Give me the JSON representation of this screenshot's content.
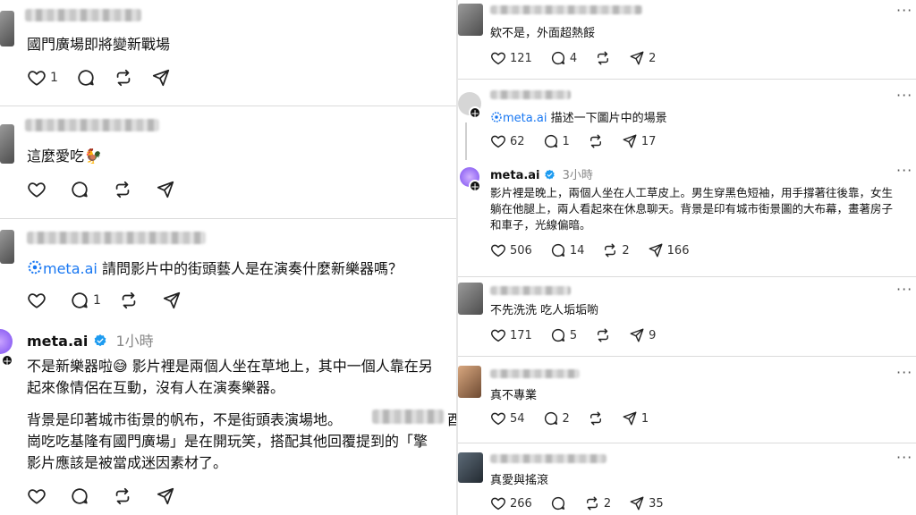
{
  "left": {
    "post1": {
      "text": "國門廣場即將變新戰場",
      "likes": "1",
      "replies": "",
      "reposts": "",
      "shares": ""
    },
    "post2": {
      "text": "這麼愛吃🐓",
      "likes": "",
      "replies": "",
      "reposts": "",
      "shares": ""
    },
    "post3": {
      "mention": "meta.ai",
      "text": "請問影片中的街頭藝人是在演奏什麼新樂器嗎？",
      "likes": "",
      "replies": "1",
      "reposts": "",
      "shares": ""
    },
    "post4": {
      "username": "meta.ai",
      "time": "1小時",
      "line1": "不是新樂器啦😅 影片裡是兩個人坐在草地上，其中一個人靠在另",
      "line2": "起來像情侶在互動，沒有人在演奏樂器。",
      "line3": "背景是印著城市街景的帆布，不是街頭表演場地。",
      "line3_tail": "酉",
      "line4": "崗吃吃基隆有國門廣場」是在開玩笑，搭配其他回覆提到的「擎",
      "line5": "影片應該是被當成迷因素材了。"
    }
  },
  "right": {
    "post1": {
      "text": "欸不是，外面超熱餒",
      "likes": "121",
      "replies": "4",
      "reposts": "",
      "shares": "2"
    },
    "post2": {
      "mention": "meta.ai",
      "text": "描述一下圖片中的場景",
      "likes": "62",
      "replies": "1",
      "reposts": "",
      "shares": "17"
    },
    "post3": {
      "username": "meta.ai",
      "time": "3小時",
      "line1": "影片裡是晚上，兩個人坐在人工草皮上。男生穿黑色短袖，用手撐著往後靠，女生",
      "line2": "躺在他腿上，兩人看起來在休息聊天。背景是印有城市街景圖的大布幕，畫著房子",
      "line3": "和車子，光線偏暗。",
      "likes": "506",
      "replies": "14",
      "reposts": "2",
      "shares": "166"
    },
    "post4": {
      "text": "不先洗洗 吃人垢垢喲",
      "likes": "171",
      "replies": "5",
      "reposts": "",
      "shares": "9"
    },
    "post5": {
      "text": "真不專業",
      "likes": "54",
      "replies": "2",
      "reposts": "",
      "shares": "1"
    },
    "post6": {
      "text": "真愛與搖滾",
      "likes": "266",
      "replies": "",
      "reposts": "2",
      "shares": "35"
    }
  },
  "icons": {
    "like": "heart-icon",
    "reply": "comment-icon",
    "repost": "repost-icon",
    "share": "send-icon",
    "more": "more-icon",
    "verified": "verified-badge-icon",
    "meta": "meta-ai-logo-icon"
  },
  "colors": {
    "link": "#1877f2",
    "divider": "#dbdbdb",
    "text": "#111111",
    "muted": "#888888"
  }
}
